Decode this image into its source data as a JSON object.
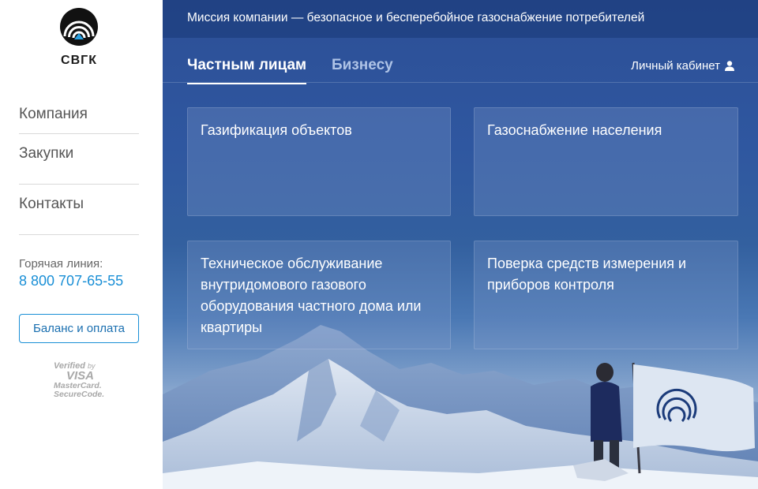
{
  "brand": {
    "name": "СВГК",
    "accent_color": "#1a8fd6",
    "logo_icon": "svgk-flame-logo"
  },
  "sidebar": {
    "nav": [
      {
        "label": "Компания"
      },
      {
        "label": "Закупки"
      },
      {
        "label": "Контакты"
      }
    ],
    "hotline_label": "Горячая линия:",
    "hotline_phone": "8 800 707-65-55",
    "pay_button": "Баланс и оплата",
    "secure_badge": {
      "line1": "Verified",
      "line1_small": "by",
      "line2": "VISA",
      "line3": "MasterCard.",
      "line4": "SecureCode."
    }
  },
  "header": {
    "mission": "Миссия компании — безопасное и бесперебойное газоснабжение потребителей",
    "tabs": [
      {
        "label": "Частным лицам",
        "active": true
      },
      {
        "label": "Бизнесу",
        "active": false
      }
    ],
    "cabinet_label": "Личный кабинет",
    "cabinet_icon": "user-icon"
  },
  "cards": [
    {
      "title": "Газификация объектов"
    },
    {
      "title": "Газоснабжение населения"
    },
    {
      "title": "Техническое обслуживание внутридомового газового оборудования частного дома или квартиры"
    },
    {
      "title": "Поверка средств измерения и приборов контроля"
    }
  ],
  "background": {
    "image": "mountain-summit-with-flag",
    "colors": {
      "sky_top": "#2c4f96",
      "snow": "#e4ebf4"
    }
  }
}
